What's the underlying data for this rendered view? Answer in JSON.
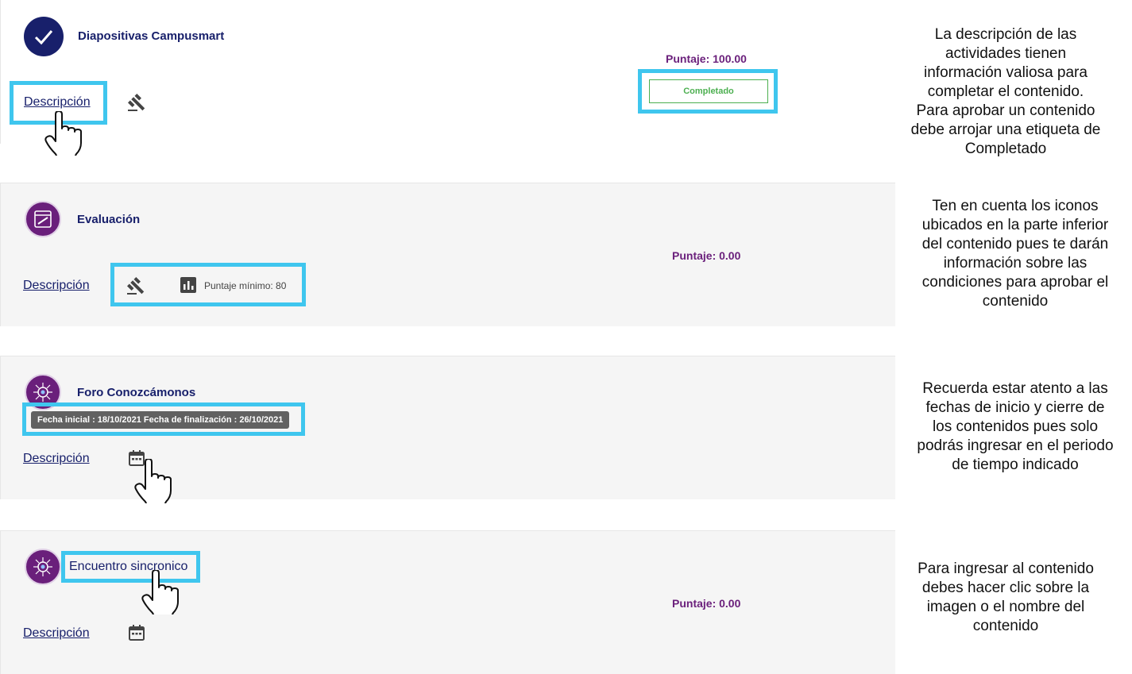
{
  "activities": [
    {
      "title": "Diapositivas Campusmart",
      "description_link": "Descripción",
      "score": "Puntaje: 100.00",
      "status_badge": "Completado",
      "icons": [
        "gavel-icon"
      ]
    },
    {
      "title": "Evaluación",
      "description_link": "Descripción",
      "score": "Puntaje: 0.00",
      "icons": [
        "gavel-icon",
        "bar-chart-icon"
      ],
      "min_score_label": "Puntaje mínimo: 80"
    },
    {
      "title": "Foro Conozcámonos",
      "description_link": "Descripción",
      "tooltip": "Fecha inicial : 18/10/2021 Fecha de finalización : 26/10/2021",
      "icons": [
        "calendar-icon"
      ]
    },
    {
      "title": "Encuentro sincronico",
      "description_link": "Descripción",
      "score": "Puntaje: 0.00",
      "icons": [
        "calendar-icon"
      ]
    }
  ],
  "notes": [
    "La descripción de las\nactividades tienen\ninformación valiosa para\ncompletar el contenido.\nPara aprobar un contenido\ndebe arrojar una etiqueta de\nCompletado",
    "Ten en cuenta los iconos\nubicados en la parte inferior\ndel contenido pues te darán\ninformación sobre las\ncondiciones para aprobar el\ncontenido",
    "Recuerda estar atento a las\nfechas de inicio y cierre de\nlos contenidos pues solo\npodrás ingresar en el periodo\nde tiempo indicado",
    "Para ingresar al contenido\ndebes hacer clic sobre la\nimagen o el nombre del\ncontenido"
  ],
  "colors": {
    "title": "#18206b",
    "score": "#6a1f7b",
    "highlight": "#3fc6ee",
    "completed": "#4caf50",
    "card_grey": "#f5f5f5"
  }
}
